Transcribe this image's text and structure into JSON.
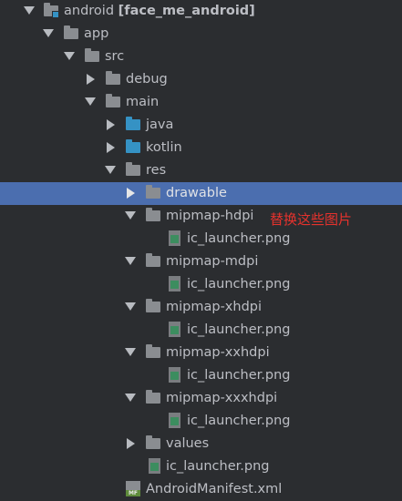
{
  "tree": {
    "root_name": "android",
    "root_module": "[face_me_android]",
    "app": "app",
    "src": "src",
    "debug": "debug",
    "main": "main",
    "java": "java",
    "kotlin": "kotlin",
    "res": "res",
    "drawable": "drawable",
    "mipmap_hdpi": "mipmap-hdpi",
    "mipmap_mdpi": "mipmap-mdpi",
    "mipmap_xhdpi": "mipmap-xhdpi",
    "mipmap_xxhdpi": "mipmap-xxhdpi",
    "mipmap_xxxhdpi": "mipmap-xxxhdpi",
    "values": "values",
    "ic_launcher": "ic_launcher.png",
    "manifest": "AndroidManifest.xml",
    "manifest_badge": "MF"
  },
  "annotation": "替换这些图片",
  "colors": {
    "selection": "#4b6eaf",
    "annotation": "#e5322d",
    "background": "#2b2d30"
  }
}
